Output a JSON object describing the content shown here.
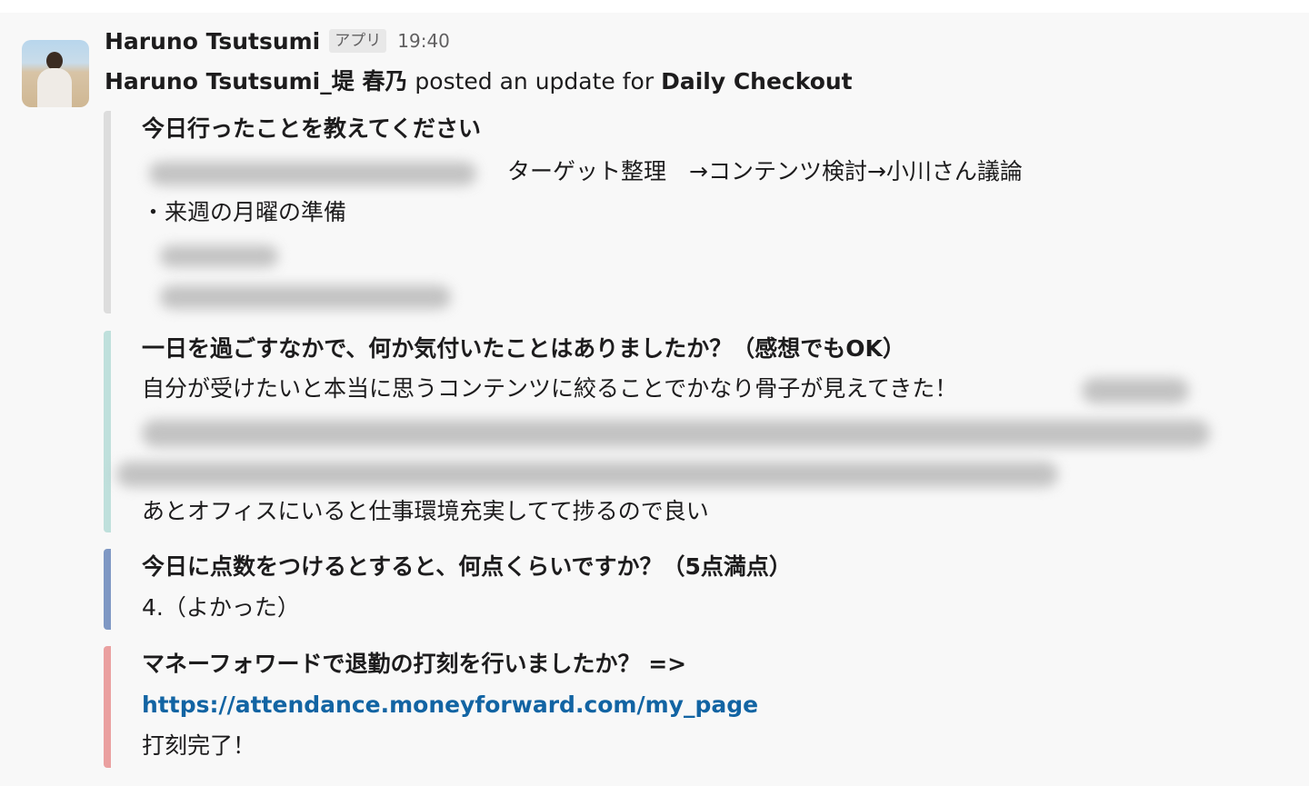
{
  "message": {
    "author": "Haruno Tsutsumi",
    "app_badge": "アプリ",
    "time": "19:40",
    "posted_author": "Haruno Tsutsumi_堤 春乃",
    "posted_middle": " posted an update for ",
    "posted_target": "Daily Checkout"
  },
  "attachments": [
    {
      "color": "#dddddd",
      "title": "今日行ったことを教えてください",
      "lines": [
        "ターゲット整理　→コンテンツ検討→小川さん議論",
        "・来週の月曜の準備"
      ]
    },
    {
      "color": "#bfe0dc",
      "title": "一日を過ごすなかで、何か気付いたことはありましたか？（感想でもOK）",
      "lines": [
        "自分が受けたいと本当に思うコンテンツに絞ることでかなり骨子が見えてきた！",
        "あとオフィスにいると仕事環境充実してて捗るので良い"
      ]
    },
    {
      "color": "#7f98c4",
      "title": "今日に点数をつけるとすると、何点くらいですか？（5点満点）",
      "lines": [
        "4.（よかった）"
      ]
    },
    {
      "color": "#eaa0a0",
      "title": "マネーフォワードで退勤の打刻を行いましたか？ =>",
      "link": "https://attendance.moneyforward.com/my_page",
      "lines": [
        "打刻完了！"
      ]
    }
  ]
}
